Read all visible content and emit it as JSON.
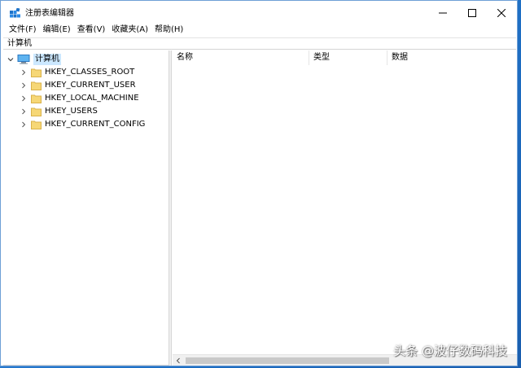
{
  "window": {
    "title": "注册表编辑器",
    "icon": "regedit-icon"
  },
  "menu": [
    {
      "label": "文件(F)"
    },
    {
      "label": "编辑(E)"
    },
    {
      "label": "查看(V)"
    },
    {
      "label": "收藏夹(A)"
    },
    {
      "label": "帮助(H)"
    }
  ],
  "address": {
    "path": "计算机"
  },
  "tree": {
    "root": {
      "label": "计算机",
      "expanded": true,
      "icon": "computer-icon"
    },
    "items": [
      {
        "label": "HKEY_CLASSES_ROOT"
      },
      {
        "label": "HKEY_CURRENT_USER"
      },
      {
        "label": "HKEY_LOCAL_MACHINE"
      },
      {
        "label": "HKEY_USERS"
      },
      {
        "label": "HKEY_CURRENT_CONFIG"
      }
    ]
  },
  "list": {
    "columns": [
      {
        "label": "名称"
      },
      {
        "label": "类型"
      },
      {
        "label": "数据"
      }
    ]
  },
  "watermark": "头条 @波仔数码科技",
  "colors": {
    "selection": "#cce8ff",
    "folder": "#f6d776",
    "accent": "#0078d7"
  }
}
